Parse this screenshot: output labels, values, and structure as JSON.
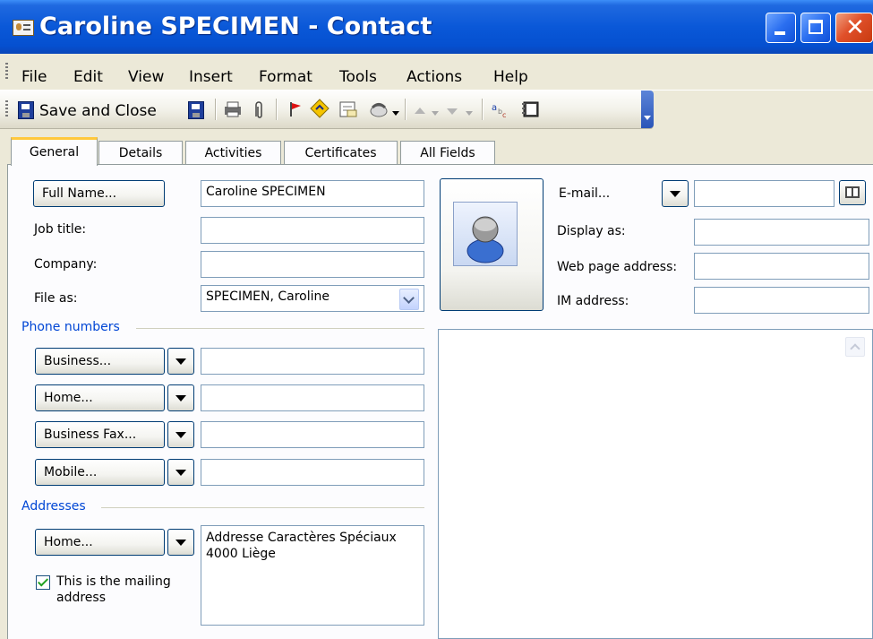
{
  "window": {
    "title": "Caroline SPECIMEN - Contact",
    "close_glyph": "✕"
  },
  "menubar": {
    "items": [
      {
        "label": "File"
      },
      {
        "label": "Edit"
      },
      {
        "label": "View"
      },
      {
        "label": "Insert"
      },
      {
        "label": "Format"
      },
      {
        "label": "Tools"
      },
      {
        "label": "Actions"
      },
      {
        "label": "Help"
      }
    ]
  },
  "toolbar": {
    "save_close_label": "Save and Close"
  },
  "tabs": [
    {
      "label": "General",
      "active": true
    },
    {
      "label": "Details"
    },
    {
      "label": "Activities"
    },
    {
      "label": "Certificates"
    },
    {
      "label": "All Fields"
    }
  ],
  "form": {
    "full_name_button": "Full Name...",
    "full_name_value": "Caroline SPECIMEN",
    "job_title_label": "Job title:",
    "job_title_value": "",
    "company_label": "Company:",
    "company_value": "",
    "file_as_label": "File as:",
    "file_as_value": "SPECIMEN, Caroline",
    "phone_group": "Phone numbers",
    "phones": [
      {
        "button": "Business...",
        "value": ""
      },
      {
        "button": "Home...",
        "value": ""
      },
      {
        "button": "Business Fax...",
        "value": ""
      },
      {
        "button": "Mobile...",
        "value": ""
      }
    ],
    "address_group": "Addresses",
    "address_button": "Home...",
    "address_line1": "Addresse Caractères Spéciaux",
    "address_line2": "4000 Liège",
    "mailing_checkbox_line1": "This is the mailing",
    "mailing_checkbox_line2": "address",
    "mailing_checked": true,
    "email_button": "E-mail...",
    "email_value": "",
    "display_as_label": "Display as:",
    "display_as_value": "",
    "web_page_label": "Web page address:",
    "web_page_value": "",
    "im_label": "IM address:",
    "im_value": "",
    "notes_value": ""
  },
  "colors": {
    "title_bar": "#0a58d8",
    "group_label": "#0046d5",
    "tab_highlight": "#ffc83c"
  }
}
